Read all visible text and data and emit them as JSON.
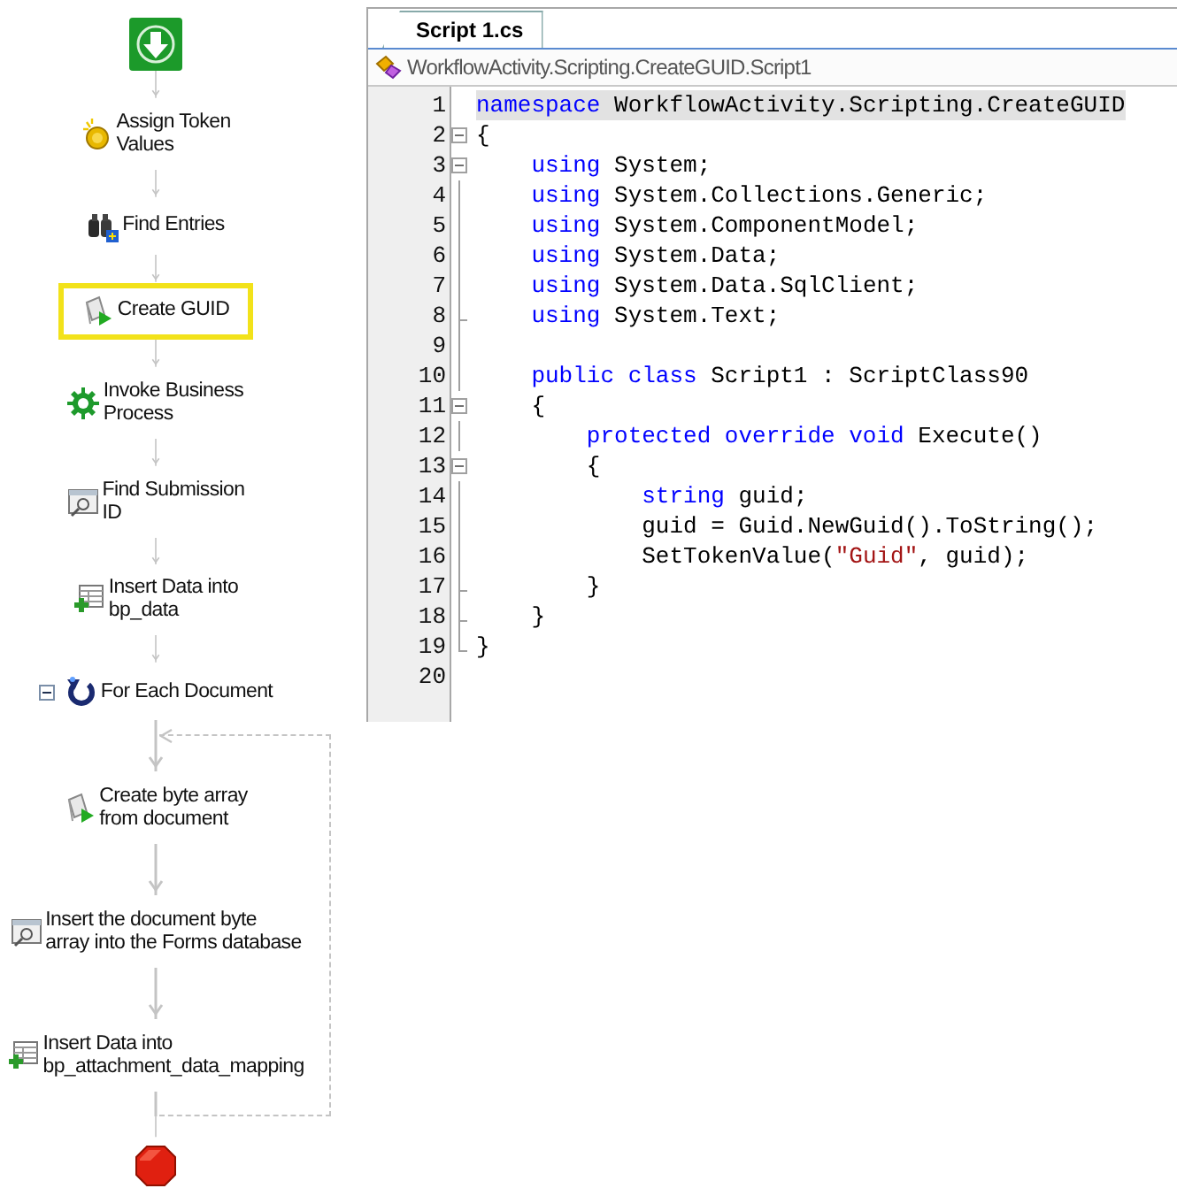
{
  "workflow": {
    "steps": [
      {
        "kind": "start",
        "selected": false
      },
      {
        "kind": "coins",
        "label": "Assign Token\nValues",
        "selected": false
      },
      {
        "kind": "binoculars",
        "label": "Find Entries",
        "selected": false
      },
      {
        "kind": "script",
        "label": "Create GUID",
        "selected": true
      },
      {
        "kind": "gear",
        "label": "Invoke Business\nProcess",
        "selected": false
      },
      {
        "kind": "search-form",
        "label": "Find Submission\nID",
        "selected": false
      },
      {
        "kind": "insert-table",
        "label": "Insert Data into\nbp_data",
        "selected": false
      },
      {
        "kind": "loop",
        "label": "For Each Document",
        "selected": false,
        "expanded": true,
        "children": [
          {
            "kind": "script",
            "label": "Create byte array\nfrom document",
            "selected": false
          },
          {
            "kind": "search-form",
            "label": "Insert the document byte\narray into the Forms database",
            "selected": false
          },
          {
            "kind": "insert-table",
            "label": "Insert Data into\nbp_attachment_data_mapping",
            "selected": false
          }
        ]
      },
      {
        "kind": "end",
        "selected": false
      }
    ]
  },
  "editor": {
    "tab": {
      "label": "Script 1.cs",
      "selected": true
    },
    "breadcrumb": "WorkflowActivity.Scripting.CreateGUID.Script1",
    "lines": [
      {
        "number": "1",
        "kind": "fold-none",
        "current": true,
        "tokens": [
          {
            "kind": "keyword",
            "text": "namespace"
          },
          {
            "kind": "plain",
            "text": " WorkflowActivity.Scripting.CreateGUID"
          }
        ]
      },
      {
        "number": "2",
        "kind": "fold-box",
        "current": false,
        "tokens": [
          {
            "kind": "plain",
            "text": "{"
          }
        ]
      },
      {
        "number": "3",
        "kind": "fold-box",
        "current": false,
        "tokens": [
          {
            "kind": "keyword",
            "text": "    using"
          },
          {
            "kind": "plain",
            "text": " System;"
          }
        ]
      },
      {
        "number": "4",
        "kind": "fold-line",
        "current": false,
        "tokens": [
          {
            "kind": "keyword",
            "text": "    using"
          },
          {
            "kind": "plain",
            "text": " System.Collections.Generic;"
          }
        ]
      },
      {
        "number": "5",
        "kind": "fold-line",
        "current": false,
        "tokens": [
          {
            "kind": "keyword",
            "text": "    using"
          },
          {
            "kind": "plain",
            "text": " System.ComponentModel;"
          }
        ]
      },
      {
        "number": "6",
        "kind": "fold-line",
        "current": false,
        "tokens": [
          {
            "kind": "keyword",
            "text": "    using"
          },
          {
            "kind": "plain",
            "text": " System.Data;"
          }
        ]
      },
      {
        "number": "7",
        "kind": "fold-line",
        "current": false,
        "tokens": [
          {
            "kind": "keyword",
            "text": "    using"
          },
          {
            "kind": "plain",
            "text": " System.Data.SqlClient;"
          }
        ]
      },
      {
        "number": "8",
        "kind": "fold-end",
        "current": false,
        "tokens": [
          {
            "kind": "keyword",
            "text": "    using"
          },
          {
            "kind": "plain",
            "text": " System.Text;"
          }
        ]
      },
      {
        "number": "9",
        "kind": "fold-line",
        "current": false
      },
      {
        "number": "10",
        "kind": "fold-line",
        "current": false,
        "tokens": [
          {
            "kind": "keyword",
            "text": "    public class"
          },
          {
            "kind": "plain",
            "text": " Script1 : ScriptClass90"
          }
        ]
      },
      {
        "number": "11",
        "kind": "fold-box",
        "current": false,
        "tokens": [
          {
            "kind": "plain",
            "text": "    {"
          }
        ]
      },
      {
        "number": "12",
        "kind": "fold-line",
        "current": false,
        "tokens": [
          {
            "kind": "keyword",
            "text": "        protected override void"
          },
          {
            "kind": "plain",
            "text": " Execute()"
          }
        ]
      },
      {
        "number": "13",
        "kind": "fold-box",
        "current": false,
        "tokens": [
          {
            "kind": "plain",
            "text": "        {"
          }
        ]
      },
      {
        "number": "14",
        "kind": "fold-line",
        "current": false,
        "tokens": [
          {
            "kind": "keyword",
            "text": "            string"
          },
          {
            "kind": "plain",
            "text": " guid;"
          }
        ]
      },
      {
        "number": "15",
        "kind": "fold-line",
        "current": false,
        "tokens": [
          {
            "kind": "plain",
            "text": "            guid = Guid.NewGuid().ToString();"
          }
        ]
      },
      {
        "number": "16",
        "kind": "fold-line",
        "current": false,
        "tokens": [
          {
            "kind": "plain",
            "text": "            SetTokenValue("
          },
          {
            "kind": "string",
            "text": "\"Guid\""
          },
          {
            "kind": "plain",
            "text": ", guid);"
          }
        ]
      },
      {
        "number": "17",
        "kind": "fold-end",
        "current": false,
        "tokens": [
          {
            "kind": "plain",
            "text": "        }"
          }
        ]
      },
      {
        "number": "18",
        "kind": "fold-end",
        "current": false,
        "tokens": [
          {
            "kind": "plain",
            "text": "    }"
          }
        ]
      },
      {
        "number": "19",
        "kind": "fold-last",
        "current": false,
        "tokens": [
          {
            "kind": "plain",
            "text": "}"
          }
        ]
      },
      {
        "number": "20",
        "kind": "fold-none",
        "current": false
      }
    ]
  }
}
